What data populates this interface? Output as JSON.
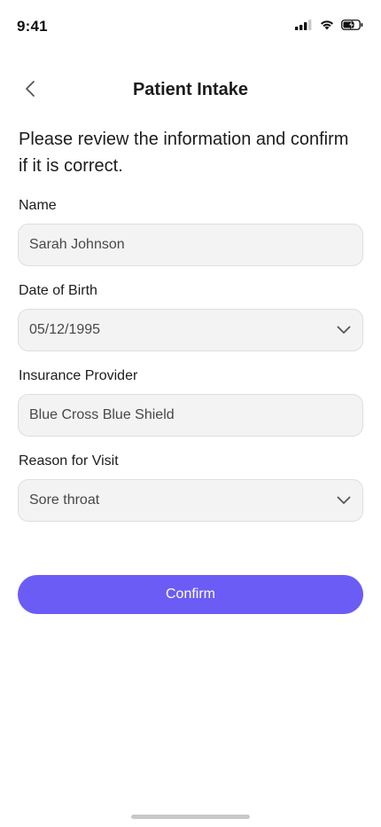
{
  "status_bar": {
    "time": "9:41",
    "icons": [
      "cellular-signal-icon",
      "wifi-icon",
      "battery-charging-icon"
    ]
  },
  "header": {
    "back_icon": "chevron-left-icon",
    "title": "Patient Intake"
  },
  "intro_text": "Please review the information and confirm if it is correct.",
  "form": {
    "name": {
      "label": "Name",
      "value": "Sarah Johnson"
    },
    "dob": {
      "label": "Date of Birth",
      "value": "05/12/1995",
      "icon": "chevron-down-icon"
    },
    "insurance": {
      "label": "Insurance Provider",
      "value": "Blue Cross Blue Shield"
    },
    "reason": {
      "label": "Reason for Visit",
      "value": "Sore throat",
      "icon": "chevron-down-icon"
    }
  },
  "confirm_label": "Confirm",
  "colors": {
    "accent": "#6b5cf6",
    "field_background": "#f3f3f3",
    "field_border": "#dedede",
    "text_primary": "#1c1c1e",
    "text_value": "#48484a"
  }
}
